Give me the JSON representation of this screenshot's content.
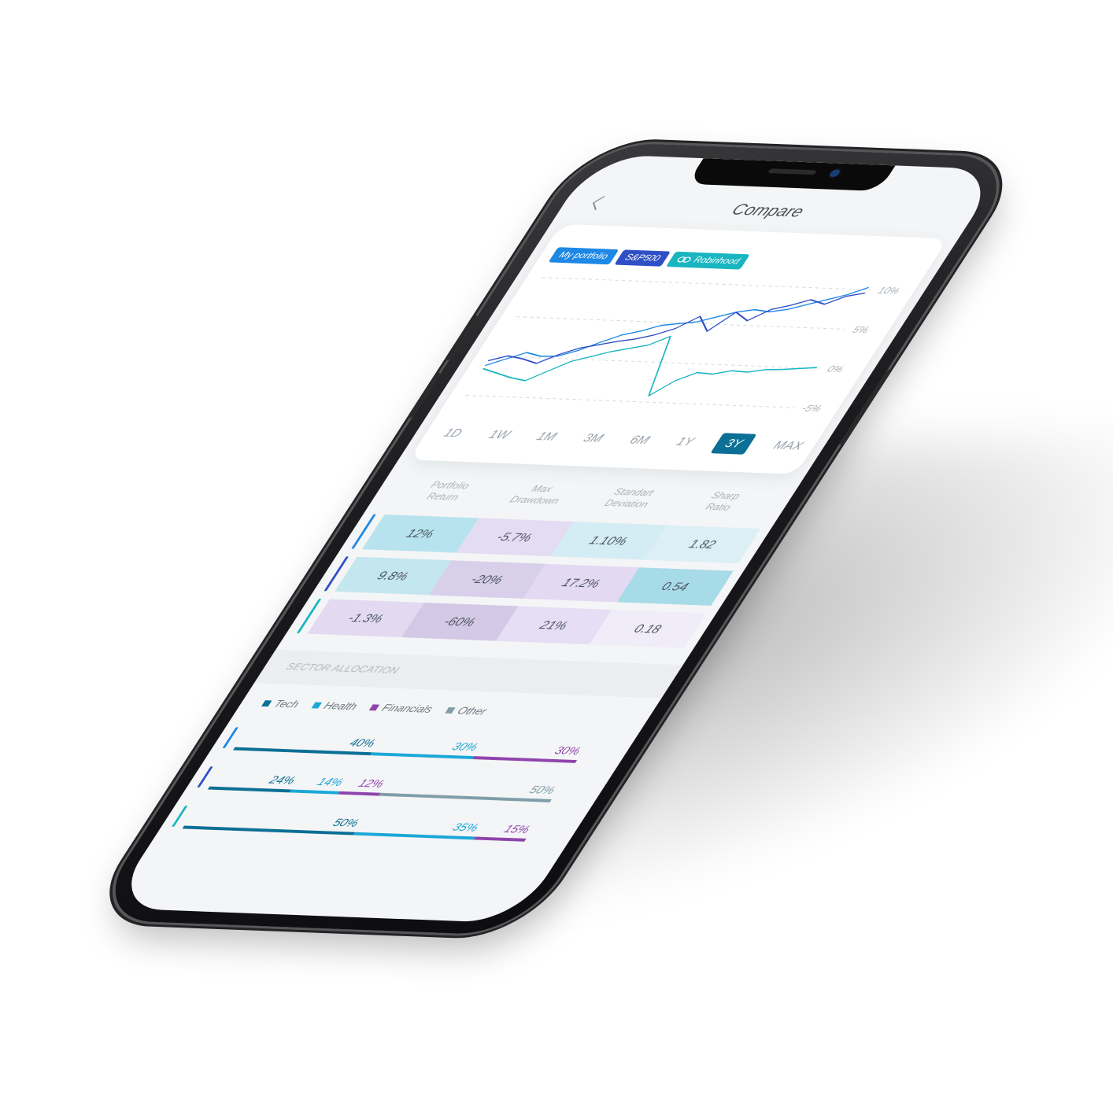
{
  "header": {
    "title": "Compare"
  },
  "colors": {
    "portfolio": "#1e88e5",
    "sp500": "#2f4fc4",
    "robinhood": "#19b5c0",
    "tech": "#0b6f96",
    "health": "#1aa8d8",
    "financials": "#8e44ad",
    "other": "#7f9ea8"
  },
  "compare_tags": [
    {
      "label": "My portfolio",
      "color": "#1e88e5"
    },
    {
      "label": "S&P500",
      "color": "#2f4fc4"
    },
    {
      "label": "Robinhood",
      "color": "#19b5c0"
    }
  ],
  "periods": [
    "1D",
    "1W",
    "1M",
    "3M",
    "6M",
    "1Y",
    "3Y",
    "MAX"
  ],
  "active_period": "3Y",
  "chart_data": {
    "type": "line",
    "y_ticks": [
      "10%",
      "5%",
      "0%",
      "-5%"
    ],
    "ylim": [
      -5,
      10
    ],
    "grid": "horizontal dashed",
    "series": [
      {
        "name": "My portfolio",
        "color": "#1e88e5",
        "values": [
          -1.2,
          -0.3,
          0.6,
          0.2,
          0.3,
          1.1,
          2.2,
          3.2,
          3.8,
          4.6,
          4.9,
          5.2,
          5.9,
          6.6,
          7.0,
          6.8,
          7.2,
          7.9,
          8.6,
          9.3,
          10.3
        ]
      },
      {
        "name": "S&P500",
        "color": "#2f4fc4",
        "values": [
          -0.6,
          0.1,
          -0.2,
          -0.7,
          0.5,
          1.4,
          1.9,
          2.4,
          2.8,
          3.4,
          4.3,
          5.9,
          4.1,
          6.6,
          5.6,
          7.1,
          7.7,
          8.5,
          8.0,
          9.1,
          9.6
        ]
      },
      {
        "name": "Robinhood",
        "color": "#19b5c0",
        "values": [
          -1.6,
          -2.1,
          -2.6,
          -2.9,
          -1.6,
          -0.3,
          0.4,
          1.1,
          1.6,
          2.1,
          3.3,
          -4.2,
          -2.2,
          -1.1,
          -1.2,
          -0.7,
          -0.8,
          -0.4,
          -0.3,
          -0.1,
          0.1
        ]
      }
    ]
  },
  "stats": {
    "headers": [
      [
        "Portfolio",
        "Return"
      ],
      [
        "Max",
        "Drawdown"
      ],
      [
        "Standart",
        "Deviation"
      ],
      [
        "Sharp",
        "Ratio"
      ]
    ],
    "rows": [
      {
        "values": [
          "12%",
          "-5.7%",
          "1.10%",
          "1.82"
        ],
        "marker": "#1e88e5",
        "bg": [
          "#b7e3ee",
          "#e4dcf2",
          "#d4ecf3",
          "#dceff4"
        ]
      },
      {
        "values": [
          "9.8%",
          "-20%",
          "17.2%",
          "0.54"
        ],
        "marker": "#2f4fc4",
        "bg": [
          "#c4e6ee",
          "#d8cfea",
          "#e3d9f2",
          "#a8dbe8"
        ]
      },
      {
        "values": [
          "-1.3%",
          "-60%",
          "21%",
          "0.18"
        ],
        "marker": "#19b5c0",
        "bg": [
          "#e3daf2",
          "#d3c8e6",
          "#e6def4",
          "#f0ecf8"
        ]
      }
    ]
  },
  "sector": {
    "title": "SECTOR ALLOCATION",
    "legend": [
      {
        "label": "Tech",
        "color": "#0b6f96"
      },
      {
        "label": "Health",
        "color": "#1aa8d8"
      },
      {
        "label": "Financials",
        "color": "#8e44ad"
      },
      {
        "label": "Other",
        "color": "#7f9ea8"
      }
    ],
    "rows": [
      {
        "marker": "#1e88e5",
        "segments": [
          {
            "sector": "Tech",
            "pct": 40,
            "label": "40%"
          },
          {
            "sector": "Health",
            "pct": 30,
            "label": "30%"
          },
          {
            "sector": "Financials",
            "pct": 30,
            "label": "30%"
          }
        ]
      },
      {
        "marker": "#2f4fc4",
        "segments": [
          {
            "sector": "Tech",
            "pct": 24,
            "label": "24%"
          },
          {
            "sector": "Health",
            "pct": 14,
            "label": "14%"
          },
          {
            "sector": "Financials",
            "pct": 12,
            "label": "12%"
          },
          {
            "sector": "Other",
            "pct": 50,
            "label": "50%"
          }
        ]
      },
      {
        "marker": "#19b5c0",
        "segments": [
          {
            "sector": "Tech",
            "pct": 50,
            "label": "50%"
          },
          {
            "sector": "Health",
            "pct": 35,
            "label": "35%"
          },
          {
            "sector": "Financials",
            "pct": 15,
            "label": "15%"
          }
        ]
      }
    ]
  }
}
